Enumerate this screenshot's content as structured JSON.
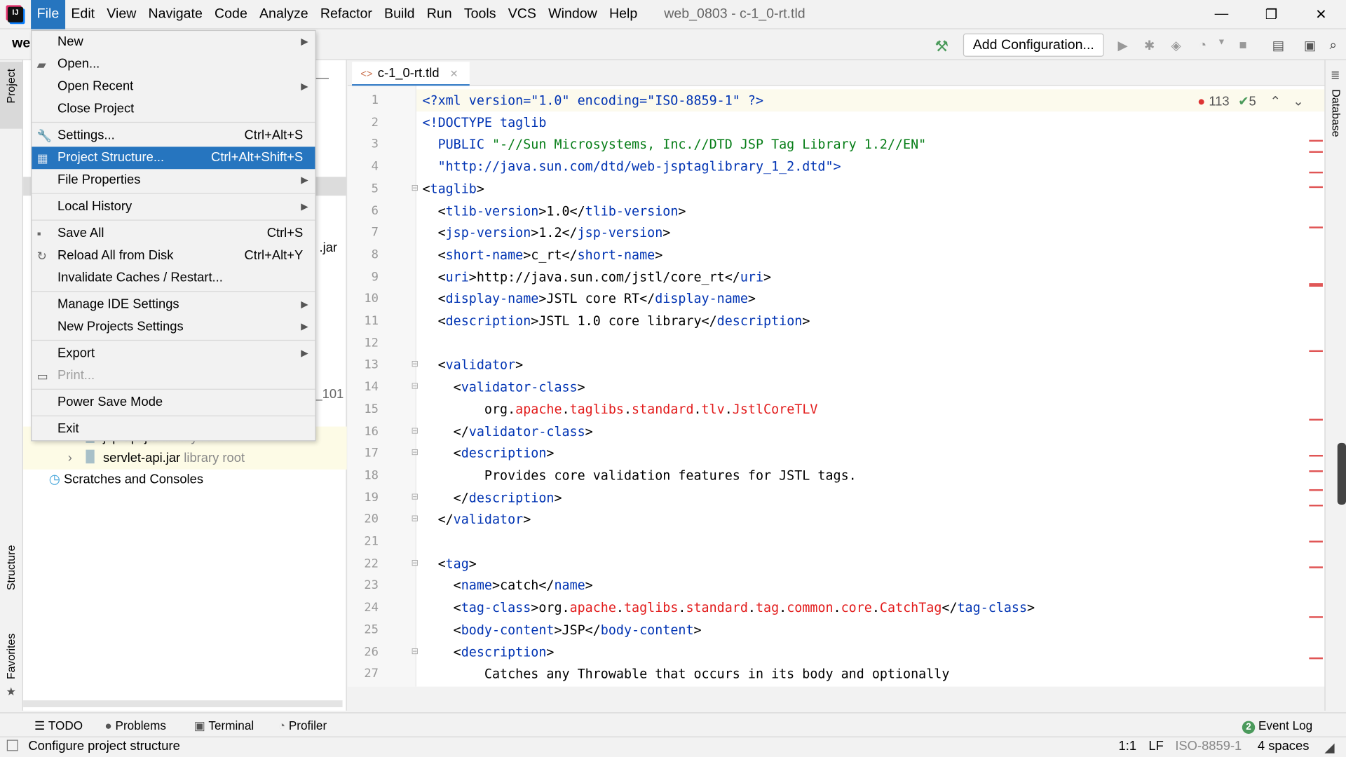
{
  "menubar": {
    "items": [
      "File",
      "Edit",
      "View",
      "Navigate",
      "Code",
      "Analyze",
      "Refactor",
      "Build",
      "Run",
      "Tools",
      "VCS",
      "Window",
      "Help"
    ],
    "active": "File",
    "window_title": "web_0803 - c-1_0-rt.tld"
  },
  "toolbar": {
    "project_short": "we",
    "add_configuration": "Add Configuration..."
  },
  "side": {
    "project": "Project",
    "structure": "Structure",
    "favorites": "Favorites",
    "database": "Database"
  },
  "file_menu": [
    {
      "label": "New",
      "submenu": true
    },
    {
      "label": "Open...",
      "icon": "folder-icon"
    },
    {
      "label": "Open Recent",
      "submenu": true
    },
    {
      "label": "Close Project"
    },
    {
      "sep": true
    },
    {
      "label": "Settings...",
      "shortcut": "Ctrl+Alt+S",
      "icon": "wrench-icon"
    },
    {
      "label": "Project Structure...",
      "shortcut": "Ctrl+Alt+Shift+S",
      "icon": "project-structure-icon",
      "selected": true
    },
    {
      "label": "File Properties",
      "submenu": true
    },
    {
      "sep": true
    },
    {
      "label": "Local History",
      "submenu": true
    },
    {
      "sep": true
    },
    {
      "label": "Save All",
      "shortcut": "Ctrl+S",
      "icon": "save-icon"
    },
    {
      "label": "Reload All from Disk",
      "shortcut": "Ctrl+Alt+Y",
      "icon": "reload-icon"
    },
    {
      "label": "Invalidate Caches / Restart..."
    },
    {
      "sep": true
    },
    {
      "label": "Manage IDE Settings",
      "submenu": true
    },
    {
      "label": "New Projects Settings",
      "submenu": true
    },
    {
      "sep": true
    },
    {
      "label": "Export",
      "submenu": true
    },
    {
      "label": "Print...",
      "icon": "print-icon",
      "disabled": true
    },
    {
      "sep": true
    },
    {
      "label": "Power Save Mode"
    },
    {
      "sep": true
    },
    {
      "label": "Exit"
    }
  ],
  "project_tree": {
    "partial_jar": ".jar",
    "partial_101": "_101",
    "items": [
      {
        "name": "jsp-api.jar",
        "hint": "library root"
      },
      {
        "name": "servlet-api.jar",
        "hint": "library root"
      }
    ],
    "scratches": "Scratches and Consoles"
  },
  "editor": {
    "tab": "c-1_0-rt.tld",
    "errors": "113",
    "warnings": "5",
    "lines": [
      [
        [
          "t",
          "<?xml version=\"1.0\" encoding=\"ISO-8859-1\" ?>"
        ]
      ],
      [
        [
          "t",
          "<!DOCTYPE taglib"
        ]
      ],
      [
        [
          "t",
          "  PUBLIC "
        ],
        [
          "s",
          "\"-//Sun Microsystems, Inc.//DTD JSP Tag Library 1.2//EN\""
        ]
      ],
      [
        [
          "t",
          "  \"http://java.sun.com/dtd/web-jsptaglibrary_1_2.dtd\">"
        ]
      ],
      [
        [
          "n",
          "<"
        ],
        [
          "t",
          "taglib"
        ],
        [
          "n",
          ">"
        ]
      ],
      [
        [
          "n",
          "  <"
        ],
        [
          "t",
          "tlib-version"
        ],
        [
          "n",
          ">1.0</"
        ],
        [
          "t",
          "tlib-version"
        ],
        [
          "n",
          ">"
        ]
      ],
      [
        [
          "n",
          "  <"
        ],
        [
          "t",
          "jsp-version"
        ],
        [
          "n",
          ">1.2</"
        ],
        [
          "t",
          "jsp-version"
        ],
        [
          "n",
          ">"
        ]
      ],
      [
        [
          "n",
          "  <"
        ],
        [
          "t",
          "short-name"
        ],
        [
          "n",
          ">c_rt</"
        ],
        [
          "t",
          "short-name"
        ],
        [
          "n",
          ">"
        ]
      ],
      [
        [
          "n",
          "  <"
        ],
        [
          "t",
          "uri"
        ],
        [
          "n",
          ">http://java.sun.com/jstl/core_rt</"
        ],
        [
          "t",
          "uri"
        ],
        [
          "n",
          ">"
        ]
      ],
      [
        [
          "n",
          "  <"
        ],
        [
          "t",
          "display-name"
        ],
        [
          "n",
          ">JSTL core RT</"
        ],
        [
          "t",
          "display-name"
        ],
        [
          "n",
          ">"
        ]
      ],
      [
        [
          "n",
          "  <"
        ],
        [
          "t",
          "description"
        ],
        [
          "n",
          ">JSTL 1.0 core library</"
        ],
        [
          "t",
          "description"
        ],
        [
          "n",
          ">"
        ]
      ],
      [],
      [
        [
          "n",
          "  <"
        ],
        [
          "t",
          "validator"
        ],
        [
          "n",
          ">"
        ]
      ],
      [
        [
          "n",
          "    <"
        ],
        [
          "t",
          "validator-class"
        ],
        [
          "n",
          ">"
        ]
      ],
      [
        [
          "n",
          "        org."
        ],
        [
          "r",
          "apache"
        ],
        [
          "n",
          "."
        ],
        [
          "r",
          "taglibs"
        ],
        [
          "n",
          "."
        ],
        [
          "r",
          "standard"
        ],
        [
          "n",
          "."
        ],
        [
          "r",
          "tlv"
        ],
        [
          "n",
          "."
        ],
        [
          "r",
          "JstlCoreTLV"
        ]
      ],
      [
        [
          "n",
          "    </"
        ],
        [
          "t",
          "validator-class"
        ],
        [
          "n",
          ">"
        ]
      ],
      [
        [
          "n",
          "    <"
        ],
        [
          "t",
          "description"
        ],
        [
          "n",
          ">"
        ]
      ],
      [
        [
          "n",
          "        Provides core validation features for JSTL tags."
        ]
      ],
      [
        [
          "n",
          "    </"
        ],
        [
          "t",
          "description"
        ],
        [
          "n",
          ">"
        ]
      ],
      [
        [
          "n",
          "  </"
        ],
        [
          "t",
          "validator"
        ],
        [
          "n",
          ">"
        ]
      ],
      [],
      [
        [
          "n",
          "  <"
        ],
        [
          "t",
          "tag"
        ],
        [
          "n",
          ">"
        ]
      ],
      [
        [
          "n",
          "    <"
        ],
        [
          "t",
          "name"
        ],
        [
          "n",
          ">catch</"
        ],
        [
          "t",
          "name"
        ],
        [
          "n",
          ">"
        ]
      ],
      [
        [
          "n",
          "    <"
        ],
        [
          "t",
          "tag-class"
        ],
        [
          "n",
          ">org."
        ],
        [
          "r",
          "apache"
        ],
        [
          "n",
          "."
        ],
        [
          "r",
          "taglibs"
        ],
        [
          "n",
          "."
        ],
        [
          "r",
          "standard"
        ],
        [
          "n",
          "."
        ],
        [
          "r",
          "tag"
        ],
        [
          "n",
          "."
        ],
        [
          "r",
          "common"
        ],
        [
          "n",
          "."
        ],
        [
          "r",
          "core"
        ],
        [
          "n",
          "."
        ],
        [
          "r",
          "CatchTag"
        ],
        [
          "n",
          "</"
        ],
        [
          "t",
          "tag-class"
        ],
        [
          "n",
          ">"
        ]
      ],
      [
        [
          "n",
          "    <"
        ],
        [
          "t",
          "body-content"
        ],
        [
          "n",
          ">JSP</"
        ],
        [
          "t",
          "body-content"
        ],
        [
          "n",
          ">"
        ]
      ],
      [
        [
          "n",
          "    <"
        ],
        [
          "t",
          "description"
        ],
        [
          "n",
          ">"
        ]
      ],
      [
        [
          "n",
          "        Catches any Throwable that occurs in its body and optionally"
        ]
      ]
    ]
  },
  "bottom_tools": {
    "todo": "TODO",
    "problems": "Problems",
    "terminal": "Terminal",
    "profiler": "Profiler",
    "event_log": "Event Log",
    "event_count": "2"
  },
  "status": {
    "message": "Configure project structure",
    "position": "1:1",
    "line_sep": "LF",
    "encoding": "ISO-8859-1",
    "indent": "4 spaces"
  },
  "colors": {
    "accent": "#2675bf",
    "tag": "#0033b3",
    "string": "#067d17",
    "error": "#e21b1b"
  }
}
